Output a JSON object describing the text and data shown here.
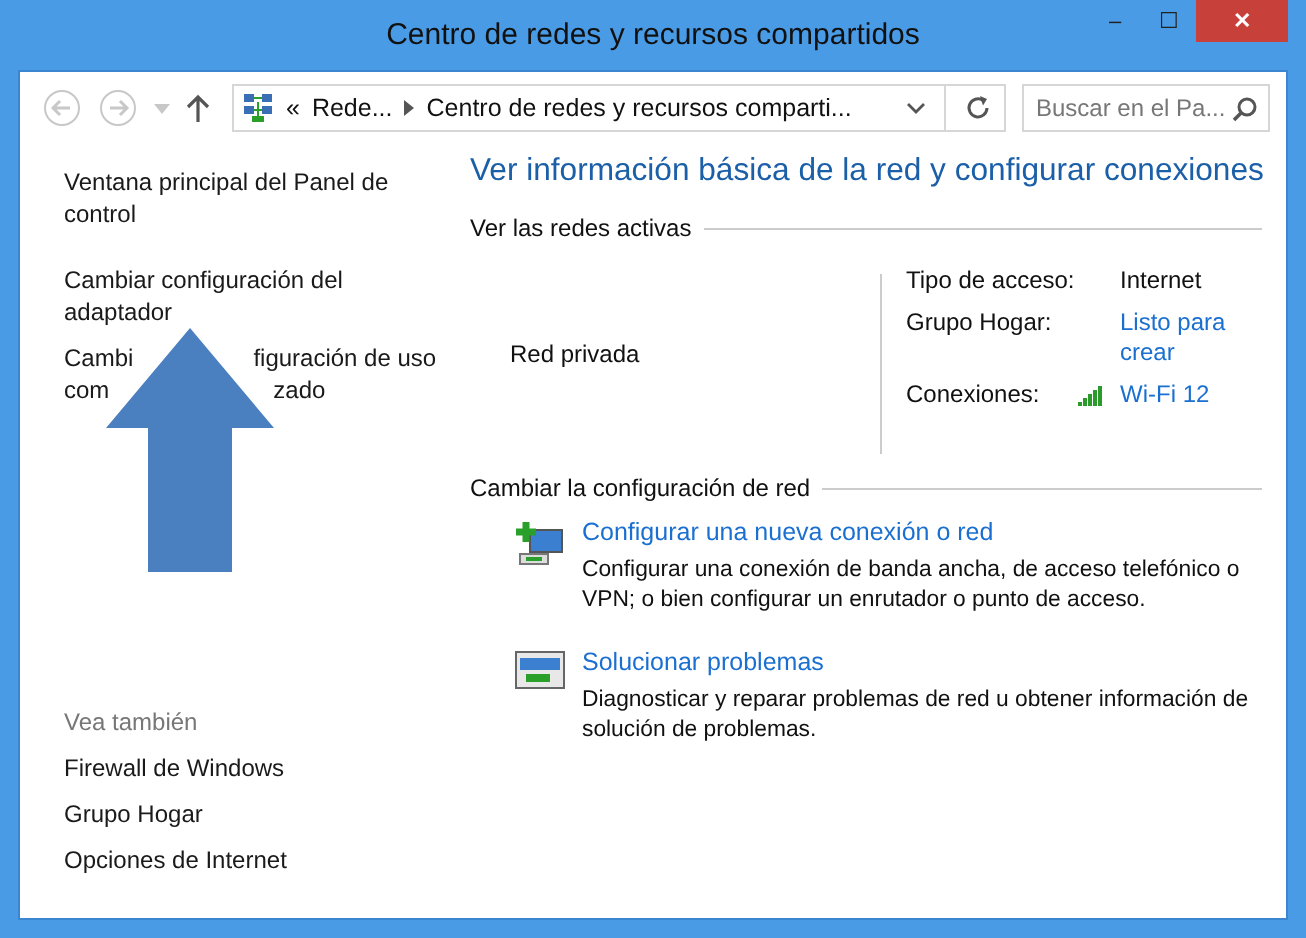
{
  "window": {
    "title": "Centro de redes y recursos compartidos",
    "controls": [
      "–",
      "☐",
      "✕"
    ]
  },
  "address_bar": {
    "breadcrumbs": [
      "«",
      "Rede...",
      "Centro de redes y recursos comparti..."
    ],
    "search_placeholder": "Buscar en el Pa..."
  },
  "sidebar": {
    "links": [
      {
        "label": "Ventana principal del Panel de control"
      },
      {
        "label": "Cambiar configuración del adaptador"
      },
      {
        "lines": [
          [
            "Cambi",
            "figuración de uso"
          ],
          [
            "com",
            "zado"
          ]
        ]
      }
    ],
    "see_also_title": "Vea también",
    "see_also": [
      "Firewall de Windows",
      "Grupo Hogar",
      "Opciones de Internet"
    ]
  },
  "main": {
    "heading": "Ver información básica de la red y configurar conexiones",
    "active_networks": {
      "title": "Ver las redes activas",
      "network_type": "Red privada",
      "properties": [
        {
          "label": "Tipo de acceso:",
          "value": "Internet",
          "kind": "text"
        },
        {
          "label": "Grupo Hogar:",
          "value": "Listo para crear",
          "kind": "link"
        },
        {
          "label": "Conexiones:",
          "value": "Wi-Fi 12",
          "kind": "wifi"
        }
      ]
    },
    "change_settings": {
      "title": "Cambiar la configuración de red",
      "tasks": [
        {
          "kind": "new-connection",
          "title": "Configurar una nueva conexión o red",
          "description": "Configurar una conexión de banda ancha, de acceso telefónico o VPN; o bien configurar un enrutador o punto de acceso."
        },
        {
          "kind": "troubleshoot",
          "title": "Solucionar problemas",
          "description": "Diagnosticar y reparar problemas de red u obtener información de solución de problemas."
        }
      ]
    }
  },
  "annotation": {
    "kind": "arrow"
  }
}
